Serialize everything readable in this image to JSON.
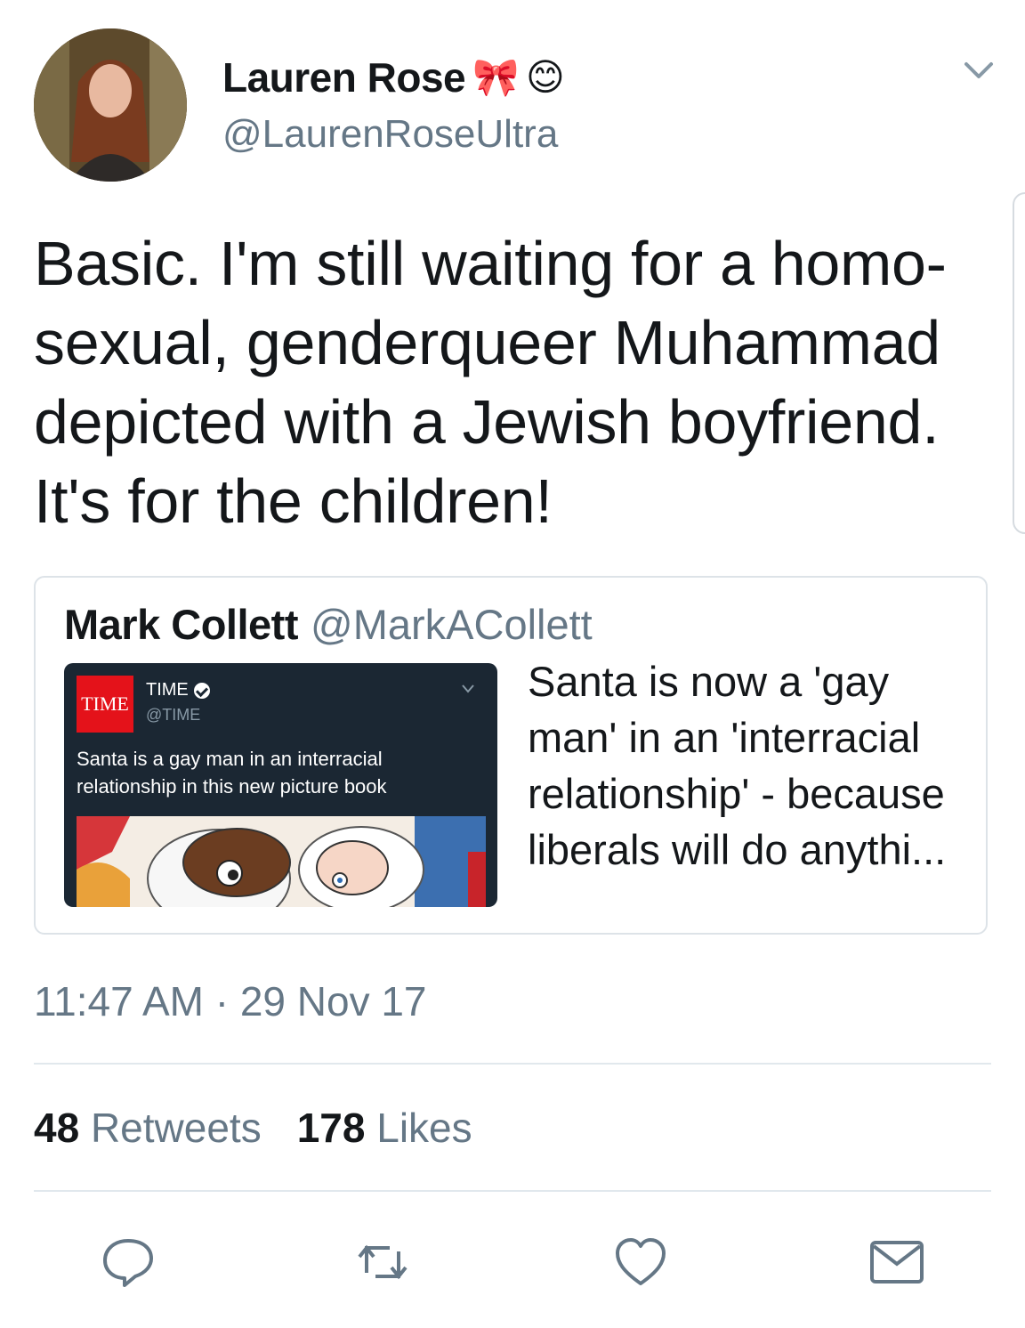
{
  "author": {
    "name": "Lauren Rose",
    "emojis": [
      "🎀",
      "😊"
    ],
    "handle": "@LaurenRoseUltra"
  },
  "tweet": {
    "text": "Basic. I'm still waiting for a homo-sexual, genderqueer Muhammad depicted with a Jewish boyfriend. It's for the children!"
  },
  "quoted": {
    "name": "Mark Collett",
    "handle": "@MarkACollett",
    "text": "Santa is now a 'gay man' in an 'interracial relationship' - because liberals will do anythi...",
    "media": {
      "logo_text": "TIME",
      "account_name": "TIME",
      "account_handle": "@TIME",
      "text": "Santa is a gay man in an interracial relationship in this new picture book"
    }
  },
  "timestamp": "11:47 AM · 29 Nov 17",
  "stats": {
    "retweets_count": "48",
    "retweets_label": "Retweets",
    "likes_count": "178",
    "likes_label": "Likes"
  },
  "actions": [
    "reply-icon",
    "retweet-icon",
    "like-icon",
    "direct-message-icon"
  ],
  "colors": {
    "text_primary": "#14171a",
    "text_secondary": "#657786",
    "divider": "#e1e8ed",
    "time_red": "#e4121a",
    "media_bg": "#1b2733"
  }
}
